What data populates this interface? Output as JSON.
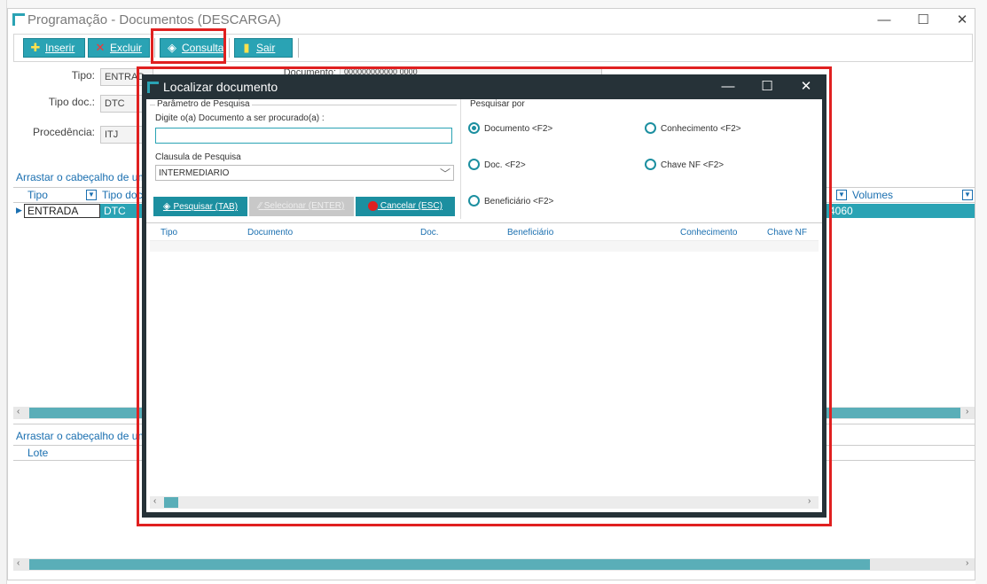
{
  "main_window": {
    "title": "Programação - Documentos (DESCARGA)",
    "controls": {
      "minimize": "—",
      "maximize": "☐",
      "close": "✕"
    }
  },
  "toolbar": {
    "insert_label": "Inserir",
    "delete_label": "Excluir",
    "consult_label": "Consultar",
    "exit_label": "Sair"
  },
  "form": {
    "tipo_label": "Tipo:",
    "tipo_value": "ENTRAD",
    "tipo_doc_label": "Tipo doc.:",
    "tipo_doc_value": "DTC",
    "procedencia_label": "Procedência:",
    "procedencia_value": "ITJ",
    "documento_label": "Documento:",
    "documento_value": "000000000000 0000"
  },
  "grid": {
    "group_hint": "Arrastar o cabeçalho de uma",
    "columns": [
      "Tipo",
      "Tipo doc",
      "Volumes"
    ],
    "row": {
      "tipo": "ENTRADA",
      "tipo_doc": "DTC",
      "volumes": "4060"
    }
  },
  "grid2": {
    "group_hint": "Arrastar o cabeçalho de uma",
    "column": "Lote"
  },
  "dialog": {
    "title": "Localizar documento",
    "param_section": "Parâmetro de Pesquisa",
    "search_prompt": "Digite o(a) Documento a ser procurado(a) :",
    "search_value": "",
    "clause_label": "Clausula de Pesquisa",
    "clause_value": "INTERMEDIARIO",
    "search_by_section": "Pesquisar por",
    "radios": {
      "documento": "Documento   <F2>",
      "conhecimento": "Conhecimento   <F2>",
      "doc": "Doc.   <F2>",
      "chave_nf": "Chave NF   <F2>",
      "beneficiario": "Beneficiário   <F2>"
    },
    "buttons": {
      "search": "Pesquisar (TAB)",
      "select": "Selecionar (ENTER)",
      "cancel": "Cancelar (ESC)"
    },
    "result_columns": [
      "Tipo",
      "Documento",
      "Doc.",
      "Beneficiário",
      "Conhecimento",
      "Chave NF"
    ]
  },
  "colors": {
    "accent": "#2aa3b4",
    "highlight": "#e02020",
    "dialog_frame": "#263238"
  }
}
